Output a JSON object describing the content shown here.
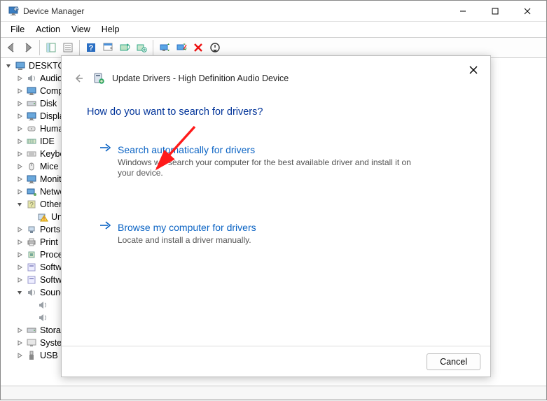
{
  "window": {
    "title": "Device Manager",
    "controls": {
      "min": "—",
      "max": "▢",
      "close": "✕"
    }
  },
  "menu": {
    "file": "File",
    "action": "Action",
    "view": "View",
    "help": "Help"
  },
  "tree": {
    "root": "DESKTOP",
    "items": [
      {
        "label": "Audio",
        "icon": "speaker"
      },
      {
        "label": "Computer",
        "icon": "monitor"
      },
      {
        "label": "Disk",
        "icon": "disk"
      },
      {
        "label": "Display",
        "icon": "monitor"
      },
      {
        "label": "Human Interface",
        "icon": "hid"
      },
      {
        "label": "IDE",
        "icon": "ide"
      },
      {
        "label": "Keyboards",
        "icon": "kbd"
      },
      {
        "label": "Mice",
        "icon": "mouse"
      },
      {
        "label": "Monitors",
        "icon": "monitor"
      },
      {
        "label": "Network",
        "icon": "net"
      },
      {
        "label": "Other",
        "icon": "other",
        "expanded": true,
        "children": [
          {
            "label": "Unknown",
            "icon": "warn"
          }
        ]
      },
      {
        "label": "Ports",
        "icon": "port"
      },
      {
        "label": "Print",
        "icon": "printer"
      },
      {
        "label": "Processors",
        "icon": "cpu"
      },
      {
        "label": "Software",
        "icon": "soft"
      },
      {
        "label": "Software components",
        "icon": "soft"
      },
      {
        "label": "Sound",
        "icon": "speaker",
        "expanded": true,
        "children": [
          {
            "label": "",
            "icon": "speaker"
          },
          {
            "label": "",
            "icon": "speaker"
          }
        ]
      },
      {
        "label": "Storage",
        "icon": "disk"
      },
      {
        "label": "System",
        "icon": "sys"
      },
      {
        "label": "USB",
        "icon": "usb"
      }
    ]
  },
  "modal": {
    "header": "Update Drivers - High Definition Audio Device",
    "question": "How do you want to search for drivers?",
    "options": [
      {
        "title": "Search automatically for drivers",
        "desc": "Windows will search your computer for the best available driver and install it on your device."
      },
      {
        "title": "Browse my computer for drivers",
        "desc": "Locate and install a driver manually."
      }
    ],
    "cancel": "Cancel"
  }
}
